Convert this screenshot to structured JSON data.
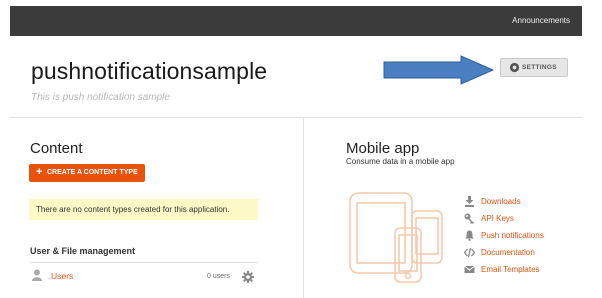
{
  "header": {
    "announcements": "Announcements"
  },
  "app": {
    "title": "pushnotificationsample",
    "subtitle": "This is push notification sample"
  },
  "settings": {
    "label": "SETTINGS",
    "icon": "gear-icon"
  },
  "content": {
    "heading": "Content",
    "create_button": {
      "icon": "plus-icon",
      "label": "CREATE A CONTENT TYPE"
    },
    "notice": "There are no content types created for this application."
  },
  "user_file_management": {
    "heading": "User & File management",
    "items": [
      {
        "label": "Users",
        "count": "0 users",
        "icon": "user-icon"
      }
    ]
  },
  "mobile_app": {
    "heading": "Mobile app",
    "subtitle": "Consume data in a mobile app",
    "links": [
      {
        "label": "Downloads",
        "icon": "download-icon"
      },
      {
        "label": "API Keys",
        "icon": "key-icon"
      },
      {
        "label": "Push notifications",
        "icon": "bell-icon"
      },
      {
        "label": "Documentation",
        "icon": "code-icon"
      },
      {
        "label": "Email Templates",
        "icon": "email-icon"
      }
    ]
  },
  "colors": {
    "accent": "#e8520f",
    "topbar": "#3b3b3b",
    "notice_bg": "#fcf9c7",
    "arrow": "#4a7fc1"
  }
}
